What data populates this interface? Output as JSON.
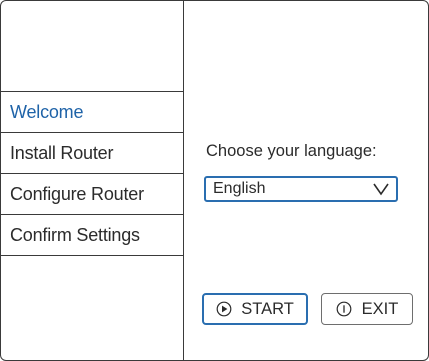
{
  "sidebar": {
    "items": [
      {
        "label": "Welcome",
        "active": true
      },
      {
        "label": "Install Router",
        "active": false
      },
      {
        "label": "Configure Router",
        "active": false
      },
      {
        "label": "Confirm Settings",
        "active": false
      }
    ]
  },
  "main": {
    "language_prompt": "Choose your language:",
    "language_select": {
      "selected": "English"
    },
    "buttons": {
      "start_label": "START",
      "exit_label": "EXIT"
    }
  },
  "colors": {
    "accent": "#2a6eb0",
    "active_text": "#1f63a8",
    "border": "#3a3a3a"
  },
  "icons": {
    "select": "chevron-down-icon",
    "start": "play-circle-icon",
    "exit": "info-circle-icon"
  }
}
